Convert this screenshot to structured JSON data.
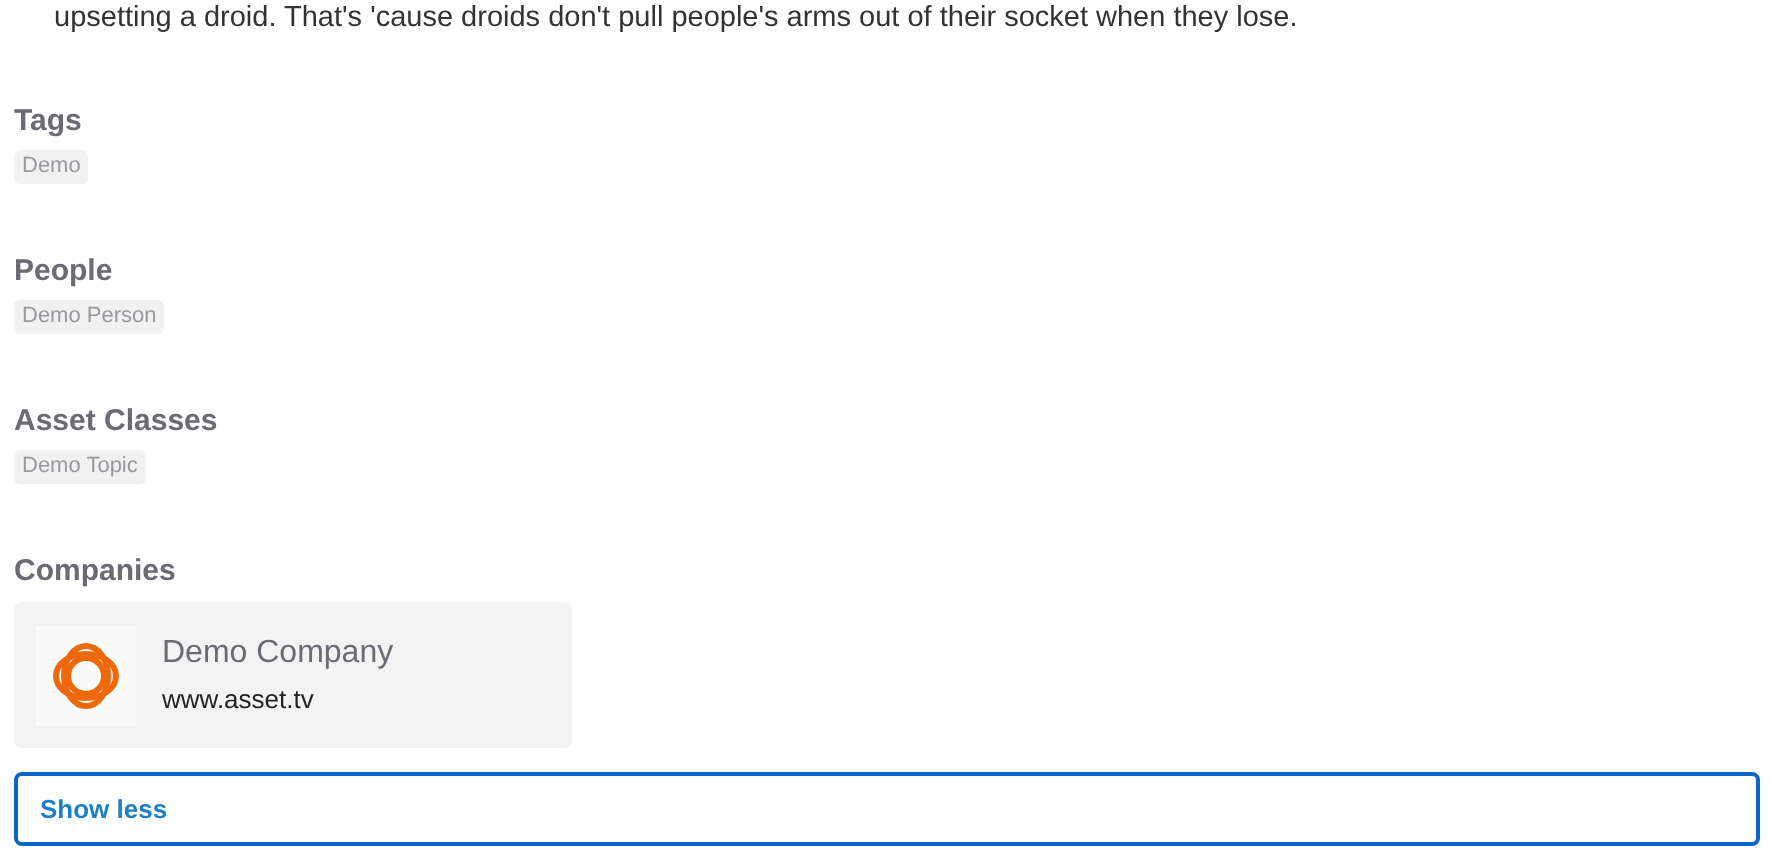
{
  "description": "upsetting a droid. That's 'cause droids don't pull people's arms out of their socket when they lose.",
  "sections": [
    {
      "title": "Tags",
      "chips": [
        "Demo"
      ]
    },
    {
      "title": "People",
      "chips": [
        "Demo Person"
      ]
    },
    {
      "title": "Asset Classes",
      "chips": [
        "Demo Topic"
      ]
    }
  ],
  "companies": {
    "title": "Companies",
    "items": [
      {
        "name": "Demo Company",
        "website": "www.asset.tv"
      }
    ]
  },
  "toggle_button": {
    "label": "Show less"
  }
}
